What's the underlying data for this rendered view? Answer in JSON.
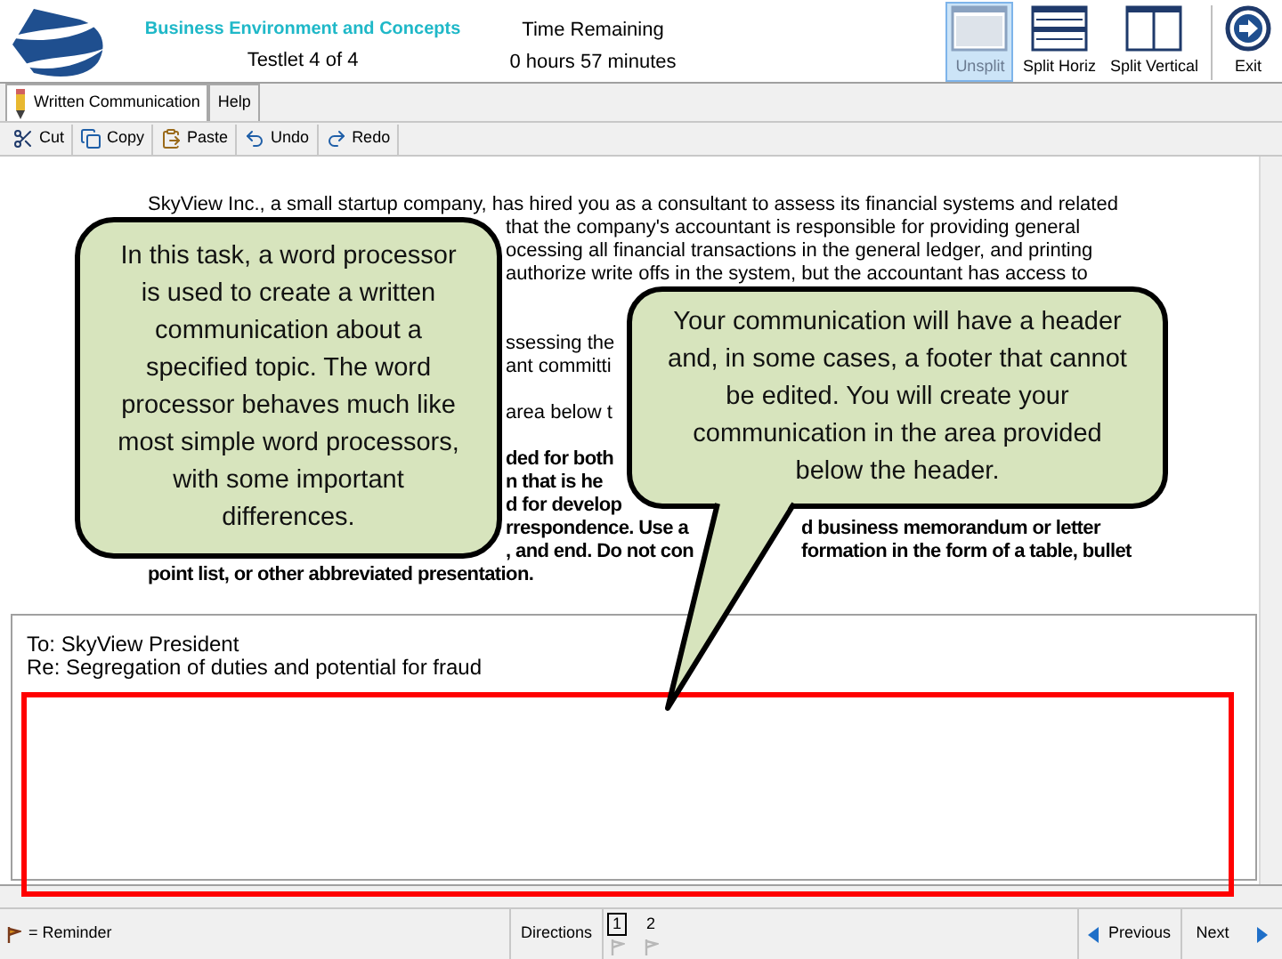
{
  "header": {
    "subject": "Business Environment and Concepts",
    "testlet": "Testlet 4 of 4",
    "timer_label": "Time Remaining",
    "timer_value": "0 hours 57 minutes"
  },
  "view_buttons": [
    {
      "label": "Unsplit",
      "kind": "unsplit",
      "selected": true
    },
    {
      "label": "Split Horiz",
      "kind": "horiz",
      "selected": false
    },
    {
      "label": "Split Vertical",
      "kind": "vertical",
      "selected": false
    }
  ],
  "exit_button": "Exit",
  "tabs": [
    {
      "label": "Written Communication",
      "selected": true
    },
    {
      "label": "Help",
      "selected": false
    }
  ],
  "toolbar": [
    {
      "label": "Cut",
      "kind": "cut"
    },
    {
      "label": "Copy",
      "kind": "copy"
    },
    {
      "label": "Paste",
      "kind": "paste"
    },
    {
      "label": "Undo",
      "kind": "undo"
    },
    {
      "label": "Redo",
      "kind": "redo"
    }
  ],
  "document": {
    "paragraphs": [
      {
        "bold": false,
        "lines": [
          {
            "kind": "full",
            "segments": [
              "SkyView Inc., a small startup company, has hired you as a consultant to assess its financial systems and related"
            ]
          },
          {
            "kind": "clipped",
            "segments": [
              "that the company's accountant is responsible for providing general"
            ]
          },
          {
            "kind": "clipped",
            "segments": [
              "ocessing all financial transactions in the general ledger, and printing"
            ]
          },
          {
            "kind": "clipped",
            "segments": [
              "authorize write offs in the system, but the accountant has access to"
            ]
          }
        ]
      },
      {
        "bold": false,
        "lines": [
          {
            "kind": "clipped",
            "segments": [
              "ssessing the"
            ]
          },
          {
            "kind": "clipped",
            "segments": [
              "ant committi"
            ]
          }
        ]
      },
      {
        "bold": false,
        "lines": [
          {
            "kind": "clipped",
            "segments": [
              "area below t"
            ]
          }
        ]
      },
      {
        "bold": true,
        "lines": [
          {
            "kind": "clipped",
            "segments": [
              "ded for both"
            ]
          },
          {
            "kind": "clipped",
            "segments": [
              "n that is he"
            ]
          },
          {
            "kind": "clipped",
            "segments": [
              "d for develop"
            ]
          },
          {
            "kind": "clipped",
            "segments": [
              "rrespondence. Use a",
              "d business memorandum or letter"
            ]
          },
          {
            "kind": "clipped",
            "segments": [
              ", and end. Do not con",
              "formation in the form of a table, bullet"
            ]
          },
          {
            "kind": "full",
            "segments": [
              "point list, or other abbreviated presentation."
            ]
          }
        ]
      }
    ]
  },
  "memo": {
    "to": "To: SkyView President",
    "re": "Re: Segregation of duties and potential for fraud"
  },
  "callouts": [
    {
      "text": "In this task, a word processor is used to create a written communication about a specified topic. The word processor behaves much like most simple word processors, with some important differences."
    },
    {
      "text": "Your communication will have a header and, in some cases, a footer that cannot be edited. You will create your communication in the area provided below the header."
    }
  ],
  "footer": {
    "reminder": "= Reminder",
    "directions": "Directions",
    "pages": [
      {
        "label": "1",
        "selected": true
      },
      {
        "label": "2",
        "selected": false
      }
    ],
    "previous": "Previous",
    "next": "Next"
  }
}
